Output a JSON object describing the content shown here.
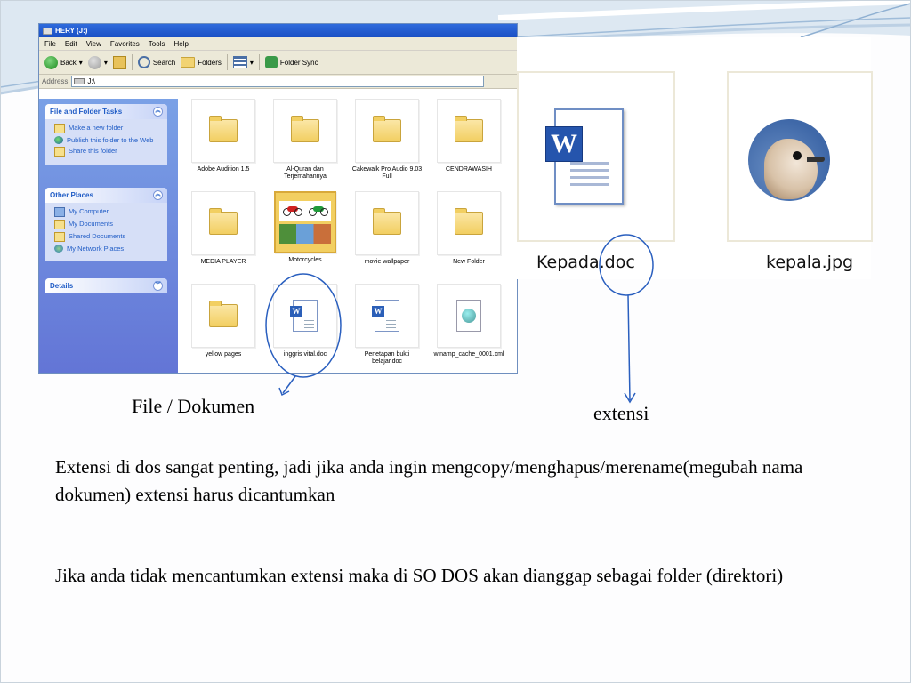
{
  "explorer": {
    "title": "HERY (J:)",
    "menu": [
      "File",
      "Edit",
      "View",
      "Favorites",
      "Tools",
      "Help"
    ],
    "toolbar": {
      "back": "Back",
      "search": "Search",
      "folders": "Folders",
      "folder_sync": "Folder Sync"
    },
    "address": {
      "label": "Address",
      "value": "J:\\"
    },
    "tasks_panel": {
      "title": "File and Folder Tasks",
      "items": [
        "Make a new folder",
        "Publish this folder to the Web",
        "Share this folder"
      ]
    },
    "places_panel": {
      "title": "Other Places",
      "items": [
        "My Computer",
        "My Documents",
        "Shared Documents",
        "My Network Places"
      ]
    },
    "details_panel": {
      "title": "Details"
    },
    "files": [
      "Adobe Audition 1.5",
      "Al-Quran dan Terjemahannya",
      "Cakewalk Pro Audio 9.03 Full",
      "CENDRAWASIH",
      "MEDIA PLAYER",
      "Motorcycles",
      "movie wallpaper",
      "New Folder",
      "yellow pages",
      "inggris vital.doc",
      "Penetapan bukti belajar.doc",
      "winamp_cache_0001.xml"
    ]
  },
  "zoom_panel": {
    "file1": "Kepada.doc",
    "file2": "kepala.jpg"
  },
  "labels": {
    "file_doc": "File / Dokumen",
    "extension": "extensi"
  },
  "paragraphs": {
    "p1": "Extensi di dos sangat penting, jadi jika anda ingin mengcopy/menghapus/merename(megubah nama dokumen) extensi harus dicantumkan",
    "p2": "Jika anda tidak mencantumkan extensi maka di SO DOS akan dianggap sebagai folder (direktori)"
  },
  "colors": {
    "annotation": "#2a5fbf",
    "xp_blue": "#215dc6",
    "panel_bg": "#7aa1e6"
  }
}
